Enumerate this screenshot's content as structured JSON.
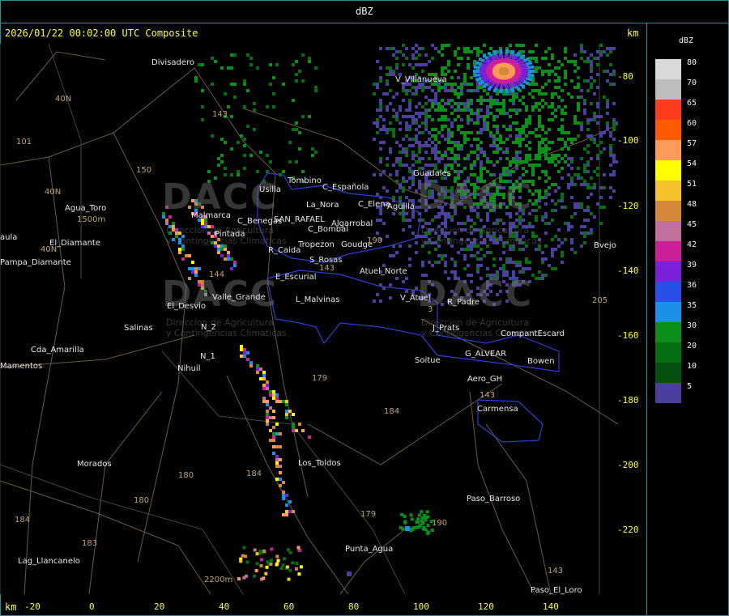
{
  "header": {
    "title": "dBZ"
  },
  "map": {
    "timestamp": "2026/01/22 00:02:00 UTC Composite",
    "unit_right": "km",
    "unit_bottom": "km",
    "x_ticks": [
      "-20",
      "0",
      "20",
      "40",
      "60",
      "80",
      "100",
      "120",
      "140"
    ],
    "y_ticks": [
      "-80",
      "-100",
      "-120",
      "-140",
      "-160",
      "-180",
      "-200",
      "-220"
    ],
    "places": [
      {
        "name": "Divisadero"
      },
      {
        "name": "V_Villanueva"
      },
      {
        "name": "Guadales"
      },
      {
        "name": "Usilla"
      },
      {
        "name": "Tombino"
      },
      {
        "name": "C_Española"
      },
      {
        "name": "La_Nora"
      },
      {
        "name": "C_Elena"
      },
      {
        "name": "Aguilla"
      },
      {
        "name": "Agua_Toro"
      },
      {
        "name": "Malmarca"
      },
      {
        "name": "C_Benegas"
      },
      {
        "name": "SAN_RAFAEL"
      },
      {
        "name": "Algarrobal"
      },
      {
        "name": "C_Bombal"
      },
      {
        "name": "Pintada"
      },
      {
        "name": "Tropezon"
      },
      {
        "name": "Goudge"
      },
      {
        "name": "R_Caida"
      },
      {
        "name": "S_Rosas"
      },
      {
        "name": "Atuel_Norte"
      },
      {
        "name": "El_Diamante"
      },
      {
        "name": "Pampa_Diamante"
      },
      {
        "name": "E_Escurial"
      },
      {
        "name": "Valle_Grande"
      },
      {
        "name": "L_Malvinas"
      },
      {
        "name": "V_Atuel"
      },
      {
        "name": "R_Padre"
      },
      {
        "name": "El_Desvio"
      },
      {
        "name": "Salinas"
      },
      {
        "name": "J_Prats"
      },
      {
        "name": "CompantEscard"
      },
      {
        "name": "Cda_Amarilla"
      },
      {
        "name": "N_1"
      },
      {
        "name": "N_2"
      },
      {
        "name": "G_ALVEAR"
      },
      {
        "name": "Soitue"
      },
      {
        "name": "Bowen"
      },
      {
        "name": "Nihuil"
      },
      {
        "name": "Aero_GH"
      },
      {
        "name": "Carmensa"
      },
      {
        "name": "Los_Toldos"
      },
      {
        "name": "Morados"
      },
      {
        "name": "Paso_Barroso"
      },
      {
        "name": "Punta_Agua"
      },
      {
        "name": "Lag_Llancanelo"
      },
      {
        "name": "Paso_El_Loro"
      },
      {
        "name": "Mamentos"
      },
      {
        "name": "aula"
      },
      {
        "name": "Bvejo"
      }
    ],
    "routes": [
      "40N",
      "40N",
      "40N",
      "101",
      "143",
      "150",
      "144",
      "143",
      "179",
      "184",
      "180",
      "184",
      "180",
      "183",
      "184",
      "179",
      "143",
      "190",
      "143",
      "205",
      "190",
      "3"
    ],
    "elevations": [
      "1500m",
      "2200m"
    ],
    "watermark": {
      "brand": "DACC",
      "line1": "Direccion de Agricultura",
      "line2": "y Contingencias Climaticas"
    }
  },
  "legend": {
    "title": "dBZ",
    "items": [
      {
        "value": "80",
        "color": "#d9d9d9"
      },
      {
        "value": "70",
        "color": "#bdbdbd"
      },
      {
        "value": "65",
        "color": "#ff3b1e"
      },
      {
        "value": "60",
        "color": "#ff5a00"
      },
      {
        "value": "57",
        "color": "#ff9a5a"
      },
      {
        "value": "54",
        "color": "#ffff00"
      },
      {
        "value": "51",
        "color": "#f5c22e"
      },
      {
        "value": "48",
        "color": "#d4883a"
      },
      {
        "value": "45",
        "color": "#c0709a"
      },
      {
        "value": "42",
        "color": "#cc1f9a"
      },
      {
        "value": "39",
        "color": "#7a20d8"
      },
      {
        "value": "36",
        "color": "#2a4fe8"
      },
      {
        "value": "35",
        "color": "#1a90e8"
      },
      {
        "value": "30",
        "color": "#0a8f1a"
      },
      {
        "value": "20",
        "color": "#066e12"
      },
      {
        "value": "10",
        "color": "#045010"
      },
      {
        "value": "5",
        "color": "#4a3f9a"
      }
    ]
  }
}
